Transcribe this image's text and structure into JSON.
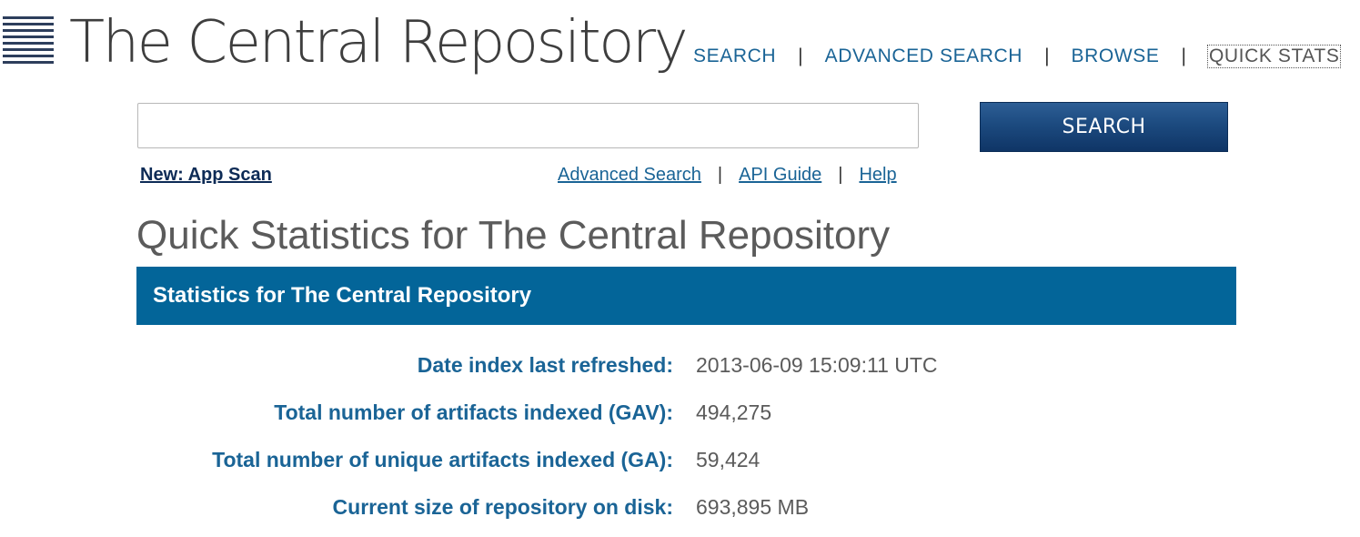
{
  "header": {
    "logo_text": "The Central Repository",
    "nav": {
      "search": "SEARCH",
      "advanced_search": "ADVANCED SEARCH",
      "browse": "BROWSE",
      "quick_stats": "QUICK STATS",
      "separator": "|"
    }
  },
  "search": {
    "value": "",
    "placeholder": "",
    "button_label": "SEARCH"
  },
  "sub_links": {
    "app_scan": "New: App Scan",
    "advanced_search": "Advanced Search",
    "api_guide": "API Guide",
    "help": "Help",
    "separator": "|"
  },
  "page_title": "Quick Statistics for The Central Repository",
  "stats_panel": {
    "heading": "Statistics for The Central Repository",
    "rows": [
      {
        "label": "Date index last refreshed:",
        "value": "2013-06-09 15:09:11 UTC"
      },
      {
        "label": "Total number of artifacts indexed (GAV):",
        "value": "494,275"
      },
      {
        "label": "Total number of unique artifacts indexed (GA):",
        "value": "59,424"
      },
      {
        "label": "Current size of repository on disk:",
        "value": "693,895 MB"
      }
    ]
  },
  "colors": {
    "link": "#1a6496",
    "panel_heading_bg": "#036599",
    "button_bg": "#1c4a7f",
    "logo_bars": "#2d3e5c"
  },
  "icons": {
    "logo": "stacked-lines-logo-icon"
  }
}
